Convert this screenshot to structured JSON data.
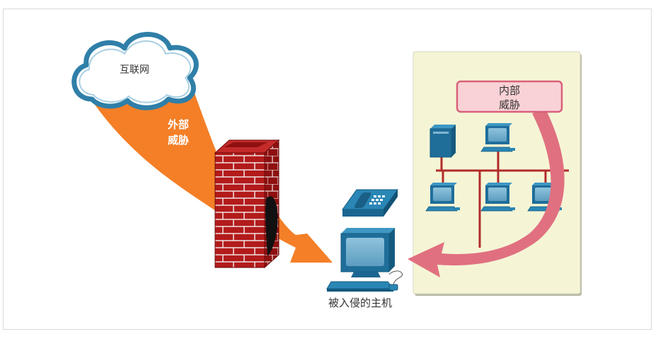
{
  "labels": {
    "internet": "互联网",
    "external_threat_line1": "外部",
    "external_threat_line2": "威胁",
    "internal_threat_line1": "内部",
    "internal_threat_line2": "威胁",
    "compromised_host": "被入侵的主机"
  },
  "colors": {
    "external_arrow": "#f47f27",
    "internal_arrow": "#e07080",
    "internal_label_bg": "#f9d2d6",
    "lan_background": "#f5f5d6",
    "brick": "#b31b1b",
    "network_line": "#b22a2a",
    "device_blue": "#1f6e9a"
  }
}
